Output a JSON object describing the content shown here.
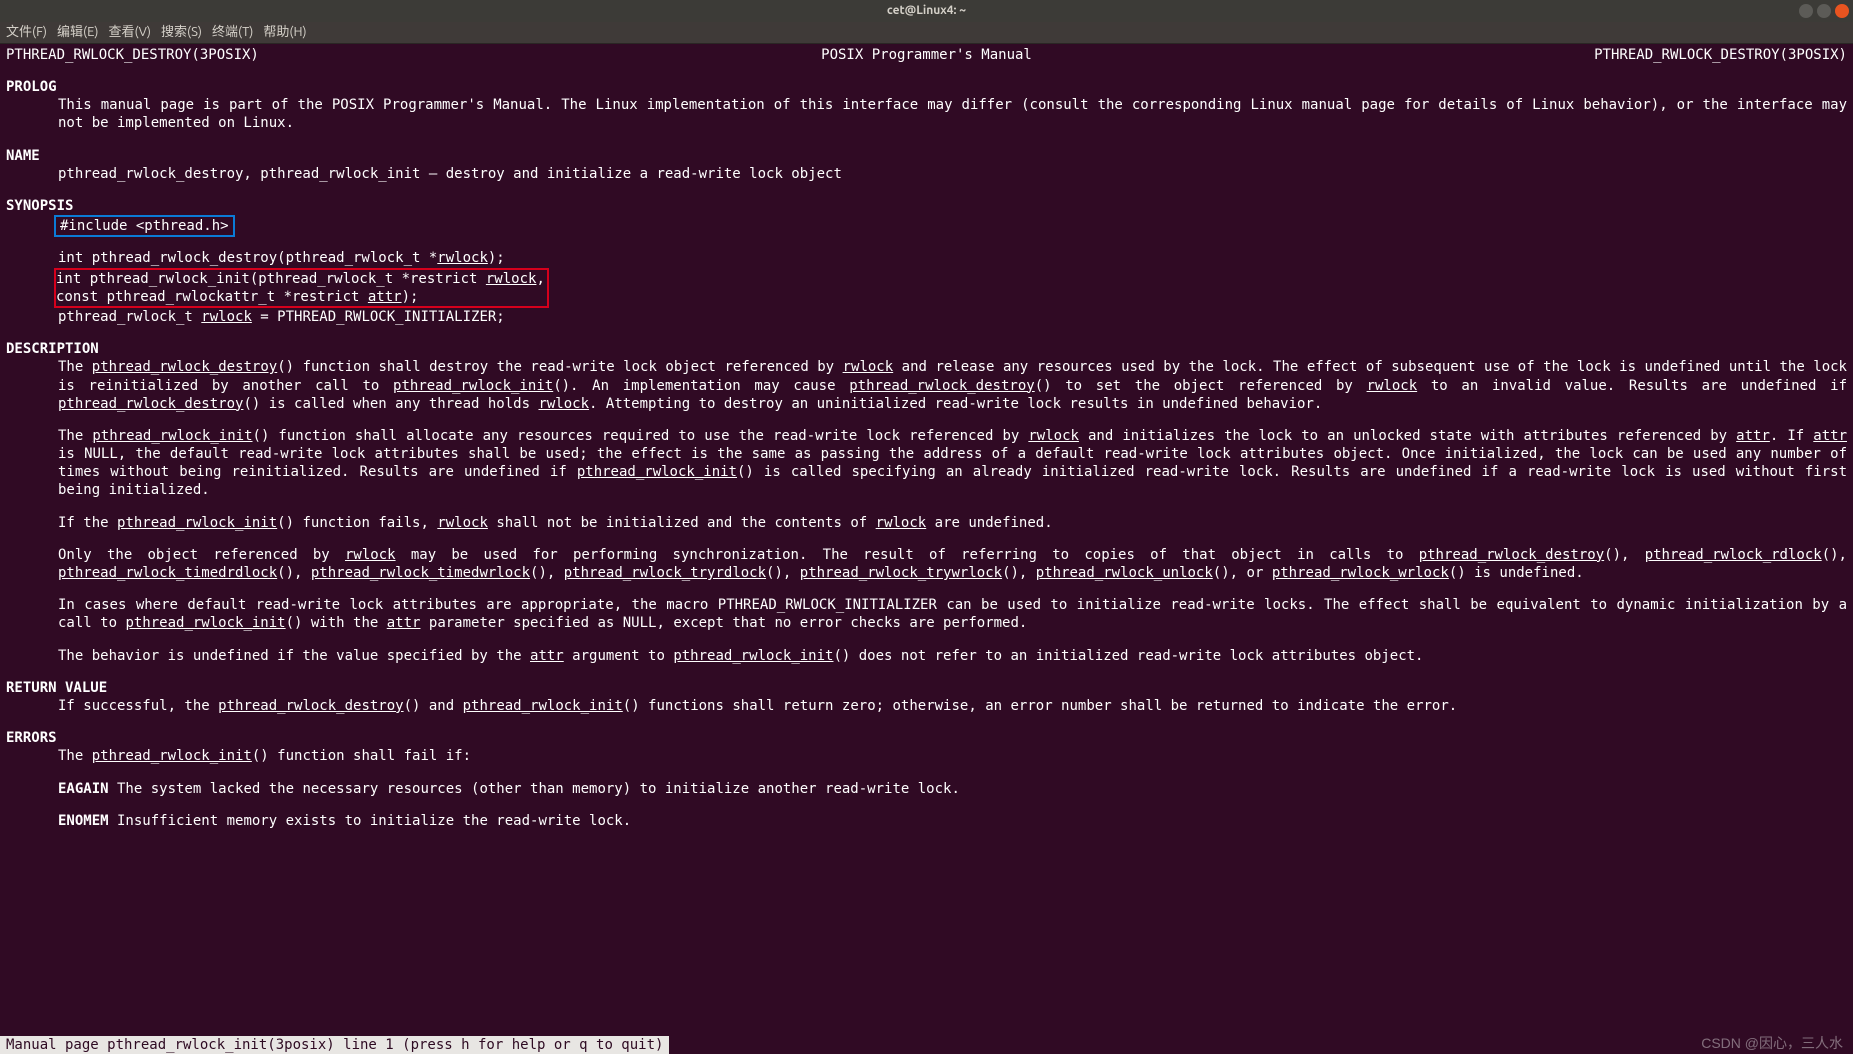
{
  "window": {
    "title": "cet@Linux4: ~"
  },
  "menu": [
    "文件(F)",
    "编辑(E)",
    "查看(V)",
    "搜索(S)",
    "终端(T)",
    "帮助(H)"
  ],
  "header": {
    "left": "PTHREAD_RWLOCK_DESTROY(3POSIX)",
    "center": "POSIX Programmer's Manual",
    "right": "PTHREAD_RWLOCK_DESTROY(3POSIX)"
  },
  "prolog": {
    "title": "PROLOG",
    "text": "This  manual page is part of the POSIX Programmer's Manual.  The Linux implementation of this interface may differ (consult the corresponding Linux manual page for details of Linux behavior), or the interface may not be implemented on Linux."
  },
  "name": {
    "title": "NAME",
    "text": "pthread_rwlock_destroy, pthread_rwlock_init — destroy and initialize a read-write lock object"
  },
  "synopsis": {
    "title": "SYNOPSIS",
    "include": "#include <pthread.h>",
    "l1a": "int pthread_rwlock_destroy(pthread_rwlock_t *",
    "l1u": "rwlock",
    "l1b": ");",
    "l2a": "int pthread_rwlock_init(pthread_rwlock_t *restrict ",
    "l2u": "rwlock",
    "l2b": ",",
    "l3a": "    const pthread_rwlockattr_t *restrict ",
    "l3u": "attr",
    "l3b": ");",
    "l4a": "pthread_rwlock_t ",
    "l4u": "rwlock",
    "l4b": " = PTHREAD_RWLOCK_INITIALIZER;"
  },
  "description": {
    "title": "DESCRIPTION"
  },
  "d1": {
    "a": "The ",
    "f1": "pthread_rwlock_destroy",
    "b": "() function shall destroy the read-write lock object referenced by ",
    "u1": "rwlock",
    "c": " and release any resources used by the lock. The  effect  of  subsequent use  of  the  lock  is undefined until the lock is reinitialized by another call to ",
    "f2": "pthread_rwlock_init",
    "d": "().  An implementation may cause ",
    "f3": "pthread_rwlock_destroy",
    "e": "() to set the object referenced by ",
    "u2": "rwlock",
    "f": " to an invalid value. Results are undefined if ",
    "f4": "pthread_rwlock_destroy",
    "g": "() is called when any thread holds ",
    "u3": "rwlock",
    "h": ".  Attempting to destroy an uninitialized read-write lock results in undefined behavior."
  },
  "d2": {
    "a": "The ",
    "f1": "pthread_rwlock_init",
    "b": "() function shall allocate any resources required to use the read-write lock referenced by ",
    "u1": "rwlock",
    "c": " and initializes the lock to an unlocked state with attributes referenced by ",
    "u2": "attr",
    "d": ".  If ",
    "u3": "attr",
    "e": " is NULL, the default read-write lock attributes shall be used; the effect is the same as passing the address  of  a  default  read-write  lock  attributes  object.  Once initialized, the lock can be used any number of times without being reinitialized. Results are undefined if ",
    "f2": "pthread_rwlock_init",
    "f": "() is called specifying an already initialized read-write lock. Results are undefined if a read-write lock is used without first being initialized."
  },
  "d3": {
    "a": "If the ",
    "f1": "pthread_rwlock_init",
    "b": "() function fails, ",
    "u1": "rwlock",
    "c": " shall not be initialized and the contents of ",
    "u2": "rwlock",
    "d": " are undefined."
  },
  "d4": {
    "a": "Only the object referenced by ",
    "u1": "rwlock",
    "b": " may be used for performing synchronization. The result of referring to copies of that object  in  calls  to  ",
    "f1": "pthread_rwlock_destroy",
    "c": "(), ",
    "f2": "pthread_rwlock_rdlock",
    "d": "(),  ",
    "f3": "pthread_rwlock_timedrdlock",
    "e": "(),  ",
    "f4": "pthread_rwlock_timedwrlock",
    "f": "(),  ",
    "f5": "pthread_rwlock_tryrdlock",
    "g": "(), ",
    "f6": "pthread_rwlock_trywrlock",
    "h": "(), ",
    "f7": "pthread_rwlock_unlock",
    "i": "(), or ",
    "f8": "pthread_rwlock_wrlock",
    "j": "() is undefined."
  },
  "d5": {
    "a": "In cases where default read-write lock attributes are appropriate, the macro PTHREAD_RWLOCK_INITIALIZER can be used to initialize read-write locks.  The  effect  shall  be equivalent to dynamic initialization by a call to ",
    "f1": "pthread_rwlock_init",
    "b": "() with the ",
    "u1": "attr",
    "c": " parameter specified as NULL, except that no error checks are performed."
  },
  "d6": {
    "a": "The behavior is undefined if the value specified by the ",
    "u1": "attr",
    "b": " argument to ",
    "f1": "pthread_rwlock_init",
    "c": "() does not refer to an initialized read-write lock attributes object."
  },
  "returnvalue": {
    "title": "RETURN VALUE",
    "a": "If successful, the ",
    "f1": "pthread_rwlock_destroy",
    "b": "() and ",
    "f2": "pthread_rwlock_init",
    "c": "() functions shall return zero; otherwise, an error number shall be returned to indicate the error."
  },
  "errors": {
    "title": "ERRORS",
    "lead_a": "The ",
    "lead_f": "pthread_rwlock_init",
    "lead_b": "() function shall fail if:",
    "e1c": "EAGAIN",
    "e1t": " The system lacked the necessary resources (other than memory) to initialize another read-write lock.",
    "e2c": "ENOMEM",
    "e2t": " Insufficient memory exists to initialize the read-write lock."
  },
  "status": " Manual page pthread_rwlock_init(3posix) line 1 (press h for help or q to quit)",
  "watermark": "CSDN @因心，三人水"
}
